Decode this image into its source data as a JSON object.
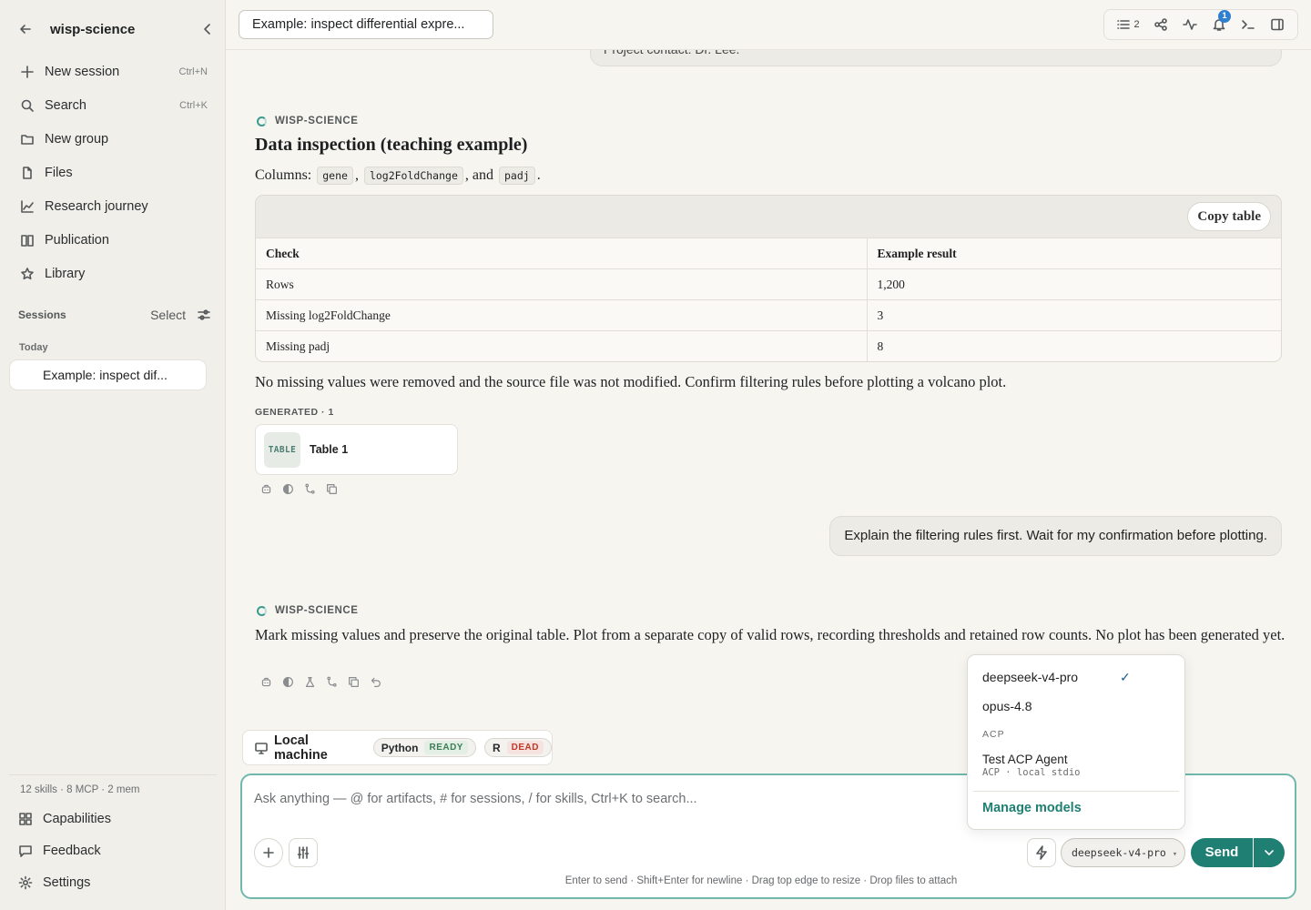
{
  "sidebar": {
    "app_name": "wisp-science",
    "nav": [
      {
        "label": "New session",
        "shortcut": "Ctrl+N",
        "icon": "plus-icon"
      },
      {
        "label": "Search",
        "shortcut": "Ctrl+K",
        "icon": "search-icon"
      },
      {
        "label": "New group",
        "icon": "folder-icon"
      },
      {
        "label": "Files",
        "icon": "file-icon"
      },
      {
        "label": "Research journey",
        "icon": "chart-line-icon"
      },
      {
        "label": "Publication",
        "icon": "book-icon"
      },
      {
        "label": "Library",
        "icon": "star-icon"
      }
    ],
    "sessions_label": "Sessions",
    "select_label": "Select",
    "today_label": "Today",
    "session_title": "Example: inspect dif...",
    "footer_meta": "12 skills · 8 MCP · 2 mem",
    "footer_nav": [
      {
        "label": "Capabilities",
        "icon": "grid-icon"
      },
      {
        "label": "Feedback",
        "icon": "message-icon"
      },
      {
        "label": "Settings",
        "icon": "gear-icon"
      }
    ]
  },
  "topbar": {
    "session_title": "Example: inspect differential expre...",
    "tasks_count": "2",
    "notification_count": "1"
  },
  "chat": {
    "previous_snippet": "Project contact: Dr. Lee.",
    "agent_name": "WISP-SCIENCE",
    "msg1": {
      "heading": "Data inspection (teaching example)",
      "columns_prefix": "Columns:",
      "col1": "gene",
      "col2": "log2FoldChange",
      "col_and": ", and",
      "col3": "padj",
      "period": ".",
      "copy_label": "Copy table",
      "table": {
        "headers": [
          "Check",
          "Example result"
        ],
        "rows": [
          [
            "Rows",
            "1,200"
          ],
          [
            "Missing log2FoldChange",
            "3"
          ],
          [
            "Missing padj",
            "8"
          ]
        ]
      },
      "summary": "No missing values were removed and the source file was not modified. Confirm filtering rules before plotting a volcano plot.",
      "generated_label": "GENERATED · 1",
      "artifact_tag": "TABLE",
      "artifact_name": "Table 1"
    },
    "user_msg": "Explain the filtering rules first. Wait for my confirmation before plotting.",
    "msg2": {
      "text": "Mark missing values and preserve the original table. Plot from a separate copy of valid rows, recording thresholds and retained row counts. No plot has been generated yet."
    }
  },
  "runtime": {
    "label": "Local machine",
    "kernels": [
      {
        "name": "Python",
        "status": "READY"
      },
      {
        "name": "R",
        "status": "DEAD"
      }
    ]
  },
  "composer": {
    "placeholder": "Ask anything — @ for artifacts, # for sessions, / for skills, Ctrl+K to search...",
    "model": "deepseek-v4-pro",
    "model_caret": "▾",
    "send_label": "Send",
    "hint": "Enter to send · Shift+Enter for newline · Drag top edge to resize · Drop files to attach"
  },
  "model_menu": {
    "models": [
      "deepseek-v4-pro",
      "opus-4.8"
    ],
    "selected_mark": "✓",
    "section_label": "ACP",
    "acp_agent": "Test ACP Agent",
    "acp_sub": "ACP · local stdio",
    "manage_label": "Manage models"
  },
  "colors": {
    "accent": "#1e7f72",
    "composer_border": "#6fb8ab",
    "ready": "#3b7d56",
    "dead": "#c0392b",
    "badge": "#2f80d0"
  }
}
